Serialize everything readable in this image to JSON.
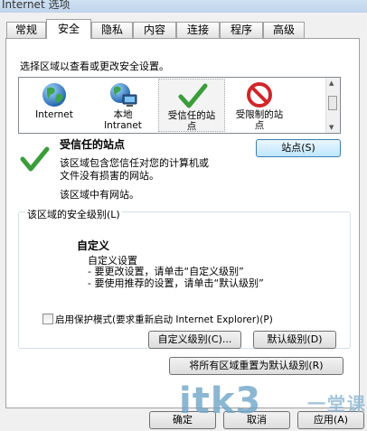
{
  "window": {
    "title": "Internet 选项"
  },
  "tabs": [
    {
      "label": "常规"
    },
    {
      "label": "安全"
    },
    {
      "label": "隐私"
    },
    {
      "label": "内容"
    },
    {
      "label": "连接"
    },
    {
      "label": "程序"
    },
    {
      "label": "高级"
    }
  ],
  "active_tab": "安全",
  "security": {
    "prompt": "选择区域以查看或更改安全设置。",
    "zones": [
      {
        "label": "Internet",
        "icon": "globe-icon"
      },
      {
        "label": "本地\nIntranet",
        "icon": "intranet-icon"
      },
      {
        "label": "受信任的站\n点",
        "icon": "check-icon"
      },
      {
        "label": "受限制的站\n点",
        "icon": "restricted-icon"
      }
    ],
    "selected_zone": {
      "title": "受信任的站点",
      "description_line1": "该区域包含您信任对您的计算机或",
      "description_line2": "文件没有损害的网站。",
      "note": "该区域中有网站。",
      "sites_button": "站点(S)"
    },
    "level_group_title": "该区域的安全级别(L)",
    "level": {
      "name": "自定义",
      "line1": "自定义设置",
      "line2": "- 要更改设置，请单击“自定义级别”",
      "line3": "- 要使用推荐的设置，请单击“默认级别”"
    },
    "protected_mode_label": "启用保护模式(要求重新启动 Internet Explorer)(P)",
    "protected_mode_checked": false,
    "custom_level_button": "自定义级别(C)...",
    "default_level_button": "默认级别(D)",
    "reset_all_button": "将所有区域重置为默认级别(R)"
  },
  "footer": {
    "ok_button": "确定",
    "cancel_button": "取消",
    "apply_button": "应用(A)"
  },
  "watermark": {
    "main": "itk3",
    "sub": "一堂课"
  }
}
